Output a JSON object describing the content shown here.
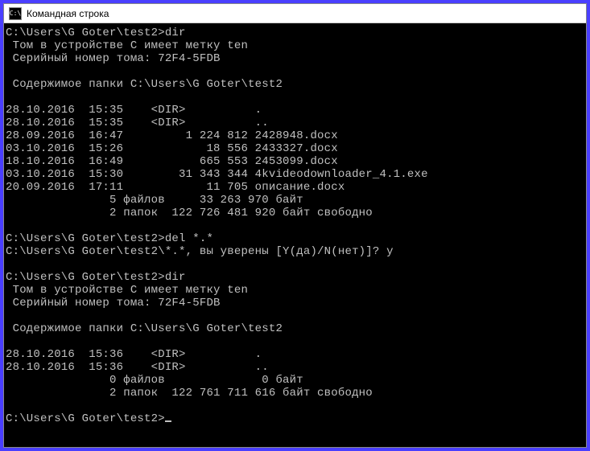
{
  "window": {
    "title": "Командная строка",
    "icon_label": "C:\\"
  },
  "terminal": {
    "l01": "C:\\Users\\G Goter\\test2>dir",
    "l02": " Том в устройстве C имеет метку ten",
    "l03": " Серийный номер тома: 72F4-5FDB",
    "l04": "",
    "l05": " Содержимое папки C:\\Users\\G Goter\\test2",
    "l06": "",
    "l07": "28.10.2016  15:35    <DIR>          .",
    "l08": "28.10.2016  15:35    <DIR>          ..",
    "l09": "28.09.2016  16:47         1 224 812 2428948.docx",
    "l10": "03.10.2016  15:26            18 556 2433327.docx",
    "l11": "18.10.2016  16:49           665 553 2453099.docx",
    "l12": "03.10.2016  15:30        31 343 344 4kvideodownloader_4.1.exe",
    "l13": "20.09.2016  17:11            11 705 описание.docx",
    "l14": "               5 файлов     33 263 970 байт",
    "l15": "               2 папок  122 726 481 920 байт свободно",
    "l16": "",
    "l17": "C:\\Users\\G Goter\\test2>del *.*",
    "l18": "C:\\Users\\G Goter\\test2\\*.*, вы уверены [Y(да)/N(нет)]? y",
    "l19": "",
    "l20": "C:\\Users\\G Goter\\test2>dir",
    "l21": " Том в устройстве C имеет метку ten",
    "l22": " Серийный номер тома: 72F4-5FDB",
    "l23": "",
    "l24": " Содержимое папки C:\\Users\\G Goter\\test2",
    "l25": "",
    "l26": "28.10.2016  15:36    <DIR>          .",
    "l27": "28.10.2016  15:36    <DIR>          ..",
    "l28": "               0 файлов              0 байт",
    "l29": "               2 папок  122 761 711 616 байт свободно",
    "l30": "",
    "l31": "C:\\Users\\G Goter\\test2>"
  }
}
